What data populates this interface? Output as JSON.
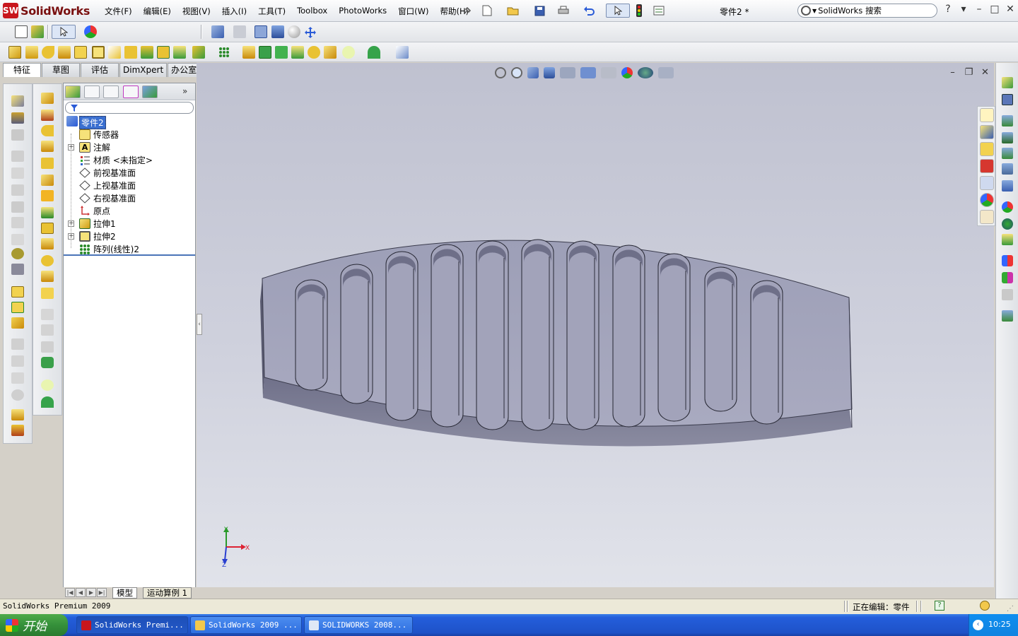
{
  "app": {
    "logo_mark": "SW",
    "name": "SolidWorks",
    "doc_title": "零件2 *"
  },
  "menu": [
    "文件(F)",
    "编辑(E)",
    "视图(V)",
    "插入(I)",
    "工具(T)",
    "Toolbox",
    "PhotoWorks",
    "窗口(W)",
    "帮助(H)"
  ],
  "search": {
    "value": "SolidWorks 搜索",
    "help": "?"
  },
  "cm_tabs": [
    "特征",
    "草图",
    "评估",
    "DimXpert",
    "办公室产品"
  ],
  "feature_tree": {
    "root": "零件2",
    "items": [
      {
        "label": "传感器",
        "expandable": false
      },
      {
        "label": "注解",
        "expandable": true
      },
      {
        "label": "材质 <未指定>",
        "expandable": false
      },
      {
        "label": "前视基准面",
        "expandable": false
      },
      {
        "label": "上视基准面",
        "expandable": false
      },
      {
        "label": "右视基准面",
        "expandable": false
      },
      {
        "label": "原点",
        "expandable": false
      },
      {
        "label": "拉伸1",
        "expandable": true
      },
      {
        "label": "拉伸2",
        "expandable": true
      },
      {
        "label": "阵列(线性)2",
        "expandable": false
      }
    ]
  },
  "bottom_tabs": {
    "model": "模型",
    "motion": "运动算例 1"
  },
  "triad": {
    "x": "X",
    "y": "Y",
    "z": "Z"
  },
  "status": {
    "app": "SolidWorks Premium 2009",
    "edit": "正在编辑：零件",
    "help": "?"
  },
  "taskbar": {
    "start": "开始",
    "tasks": [
      "SolidWorks Premi...",
      "SolidWorks 2009 ...",
      "SOLIDWORKS 2008..."
    ],
    "clock": "10:25"
  },
  "colors": {
    "viewport_top": "#bfc1d0",
    "part_top": "#a4a5bc",
    "part_side": "#7a7b8f",
    "accent_red": "#c8161d"
  }
}
